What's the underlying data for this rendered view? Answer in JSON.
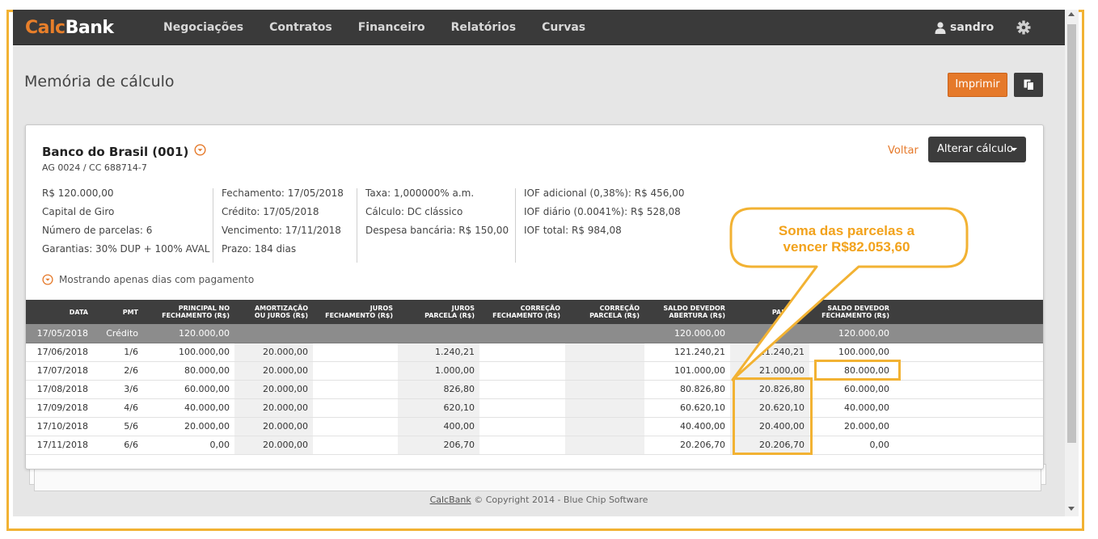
{
  "app": {
    "logo_calc": "Calc",
    "logo_bank": "Bank",
    "nav": [
      "Negociações",
      "Contratos",
      "Financeiro",
      "Relatórios",
      "Curvas"
    ],
    "user": "sandro"
  },
  "page": {
    "title": "Memória de cálculo",
    "print_label": "Imprimir"
  },
  "card": {
    "bank": "Banco do Brasil (001)",
    "agency": "AG 0024 / CC 688714-7",
    "back_label": "Voltar",
    "alter_label": "Alterar cálculo",
    "info_col1": [
      "R$ 120.000,00",
      "Capital de Giro",
      "Número de parcelas: 6",
      "Garantias: 30% DUP + 100% AVAL"
    ],
    "info_col2": [
      "Fechamento: 17/05/2018",
      "Crédito: 17/05/2018",
      "Vencimento: 17/11/2018",
      "Prazo: 184 dias"
    ],
    "info_col3": [
      "Taxa: 1,000000% a.m.",
      "Cálculo: DC clássico",
      "Despesa bancária: R$ 150,00"
    ],
    "info_col4": [
      "IOF adicional (0,38%): R$ 456,00",
      "IOF diário (0.0041%): R$ 528,08",
      "IOF total: R$ 984,08"
    ],
    "note": "Mostrando apenas dias com pagamento"
  },
  "table": {
    "headers": [
      [
        "DATA"
      ],
      [
        "PMT"
      ],
      [
        "PRINCIPAL NO",
        "FECHAMENTO (R$)"
      ],
      [
        "AMORTIZAÇÃO",
        "OU JUROS (R$)"
      ],
      [
        "JUROS",
        "FECHAMENTO (R$)"
      ],
      [
        "JUROS",
        "PARCELA (R$)"
      ],
      [
        "CORREÇÃO",
        "FECHAMENTO (R$)"
      ],
      [
        "CORREÇÃO",
        "PARCELA (R$)"
      ],
      [
        "SALDO DEVEDOR",
        "ABERTURA (R$)"
      ],
      [
        "PARCELA"
      ],
      [
        "SALDO DEVEDOR",
        "FECHAMENTO (R$)"
      ]
    ],
    "rows": [
      [
        "17/05/2018",
        "Crédito",
        "120.000,00",
        "",
        "",
        "",
        "",
        "",
        "120.000,00",
        "",
        "120.000,00"
      ],
      [
        "17/06/2018",
        "1/6",
        "100.000,00",
        "20.000,00",
        "",
        "1.240,21",
        "",
        "",
        "121.240,21",
        "21.240,21",
        "100.000,00"
      ],
      [
        "17/07/2018",
        "2/6",
        "80.000,00",
        "20.000,00",
        "",
        "1.000,00",
        "",
        "",
        "101.000,00",
        "21.000,00",
        "80.000,00"
      ],
      [
        "17/08/2018",
        "3/6",
        "60.000,00",
        "20.000,00",
        "",
        "826,80",
        "",
        "",
        "80.826,80",
        "20.826,80",
        "60.000,00"
      ],
      [
        "17/09/2018",
        "4/6",
        "40.000,00",
        "20.000,00",
        "",
        "620,10",
        "",
        "",
        "60.620,10",
        "20.620,10",
        "40.000,00"
      ],
      [
        "17/10/2018",
        "5/6",
        "20.000,00",
        "20.000,00",
        "",
        "400,00",
        "",
        "",
        "40.400,00",
        "20.400,00",
        "20.000,00"
      ],
      [
        "17/11/2018",
        "6/6",
        "0,00",
        "20.000,00",
        "",
        "206,70",
        "",
        "",
        "20.206,70",
        "20.206,70",
        "0,00"
      ]
    ]
  },
  "footer": {
    "link": "CalcBank",
    "text": "© Copyright 2014 - Blue Chip Software"
  },
  "annotation": {
    "line1": "Soma das parcelas a",
    "line2": "vencer R$82.053,60"
  },
  "colors": {
    "accent": "#e5792a",
    "annotation": "#f2b233",
    "navbar": "#3a3a3a"
  }
}
